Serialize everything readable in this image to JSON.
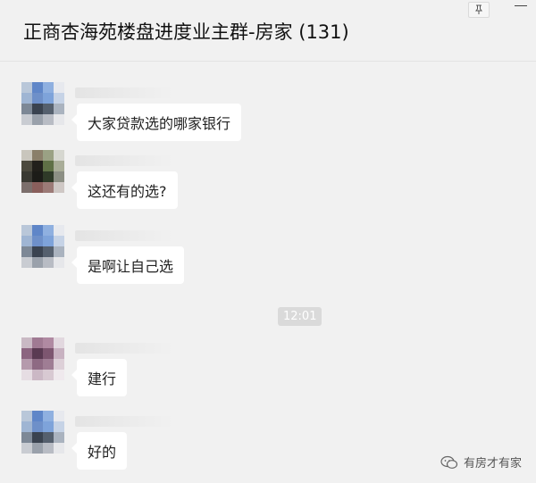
{
  "header": {
    "title": "正商杏海苑楼盘进度业主群-房家 (131)"
  },
  "messages": [
    {
      "text": "大家贷款选的哪家银行"
    },
    {
      "text": "这还有的选?"
    },
    {
      "text": "是啊让自己选"
    },
    {
      "text": "建行"
    },
    {
      "text": "好的"
    }
  ],
  "timestamp": "12:01",
  "watermark": {
    "text": "有房才有家"
  },
  "colors": {
    "background": "#f1f1f1",
    "bubble": "#ffffff",
    "timestamp_bg": "#dadada"
  },
  "icons": {
    "pin": "pin-icon",
    "minimize": "minimize-icon",
    "watermark": "wechat-icon"
  }
}
